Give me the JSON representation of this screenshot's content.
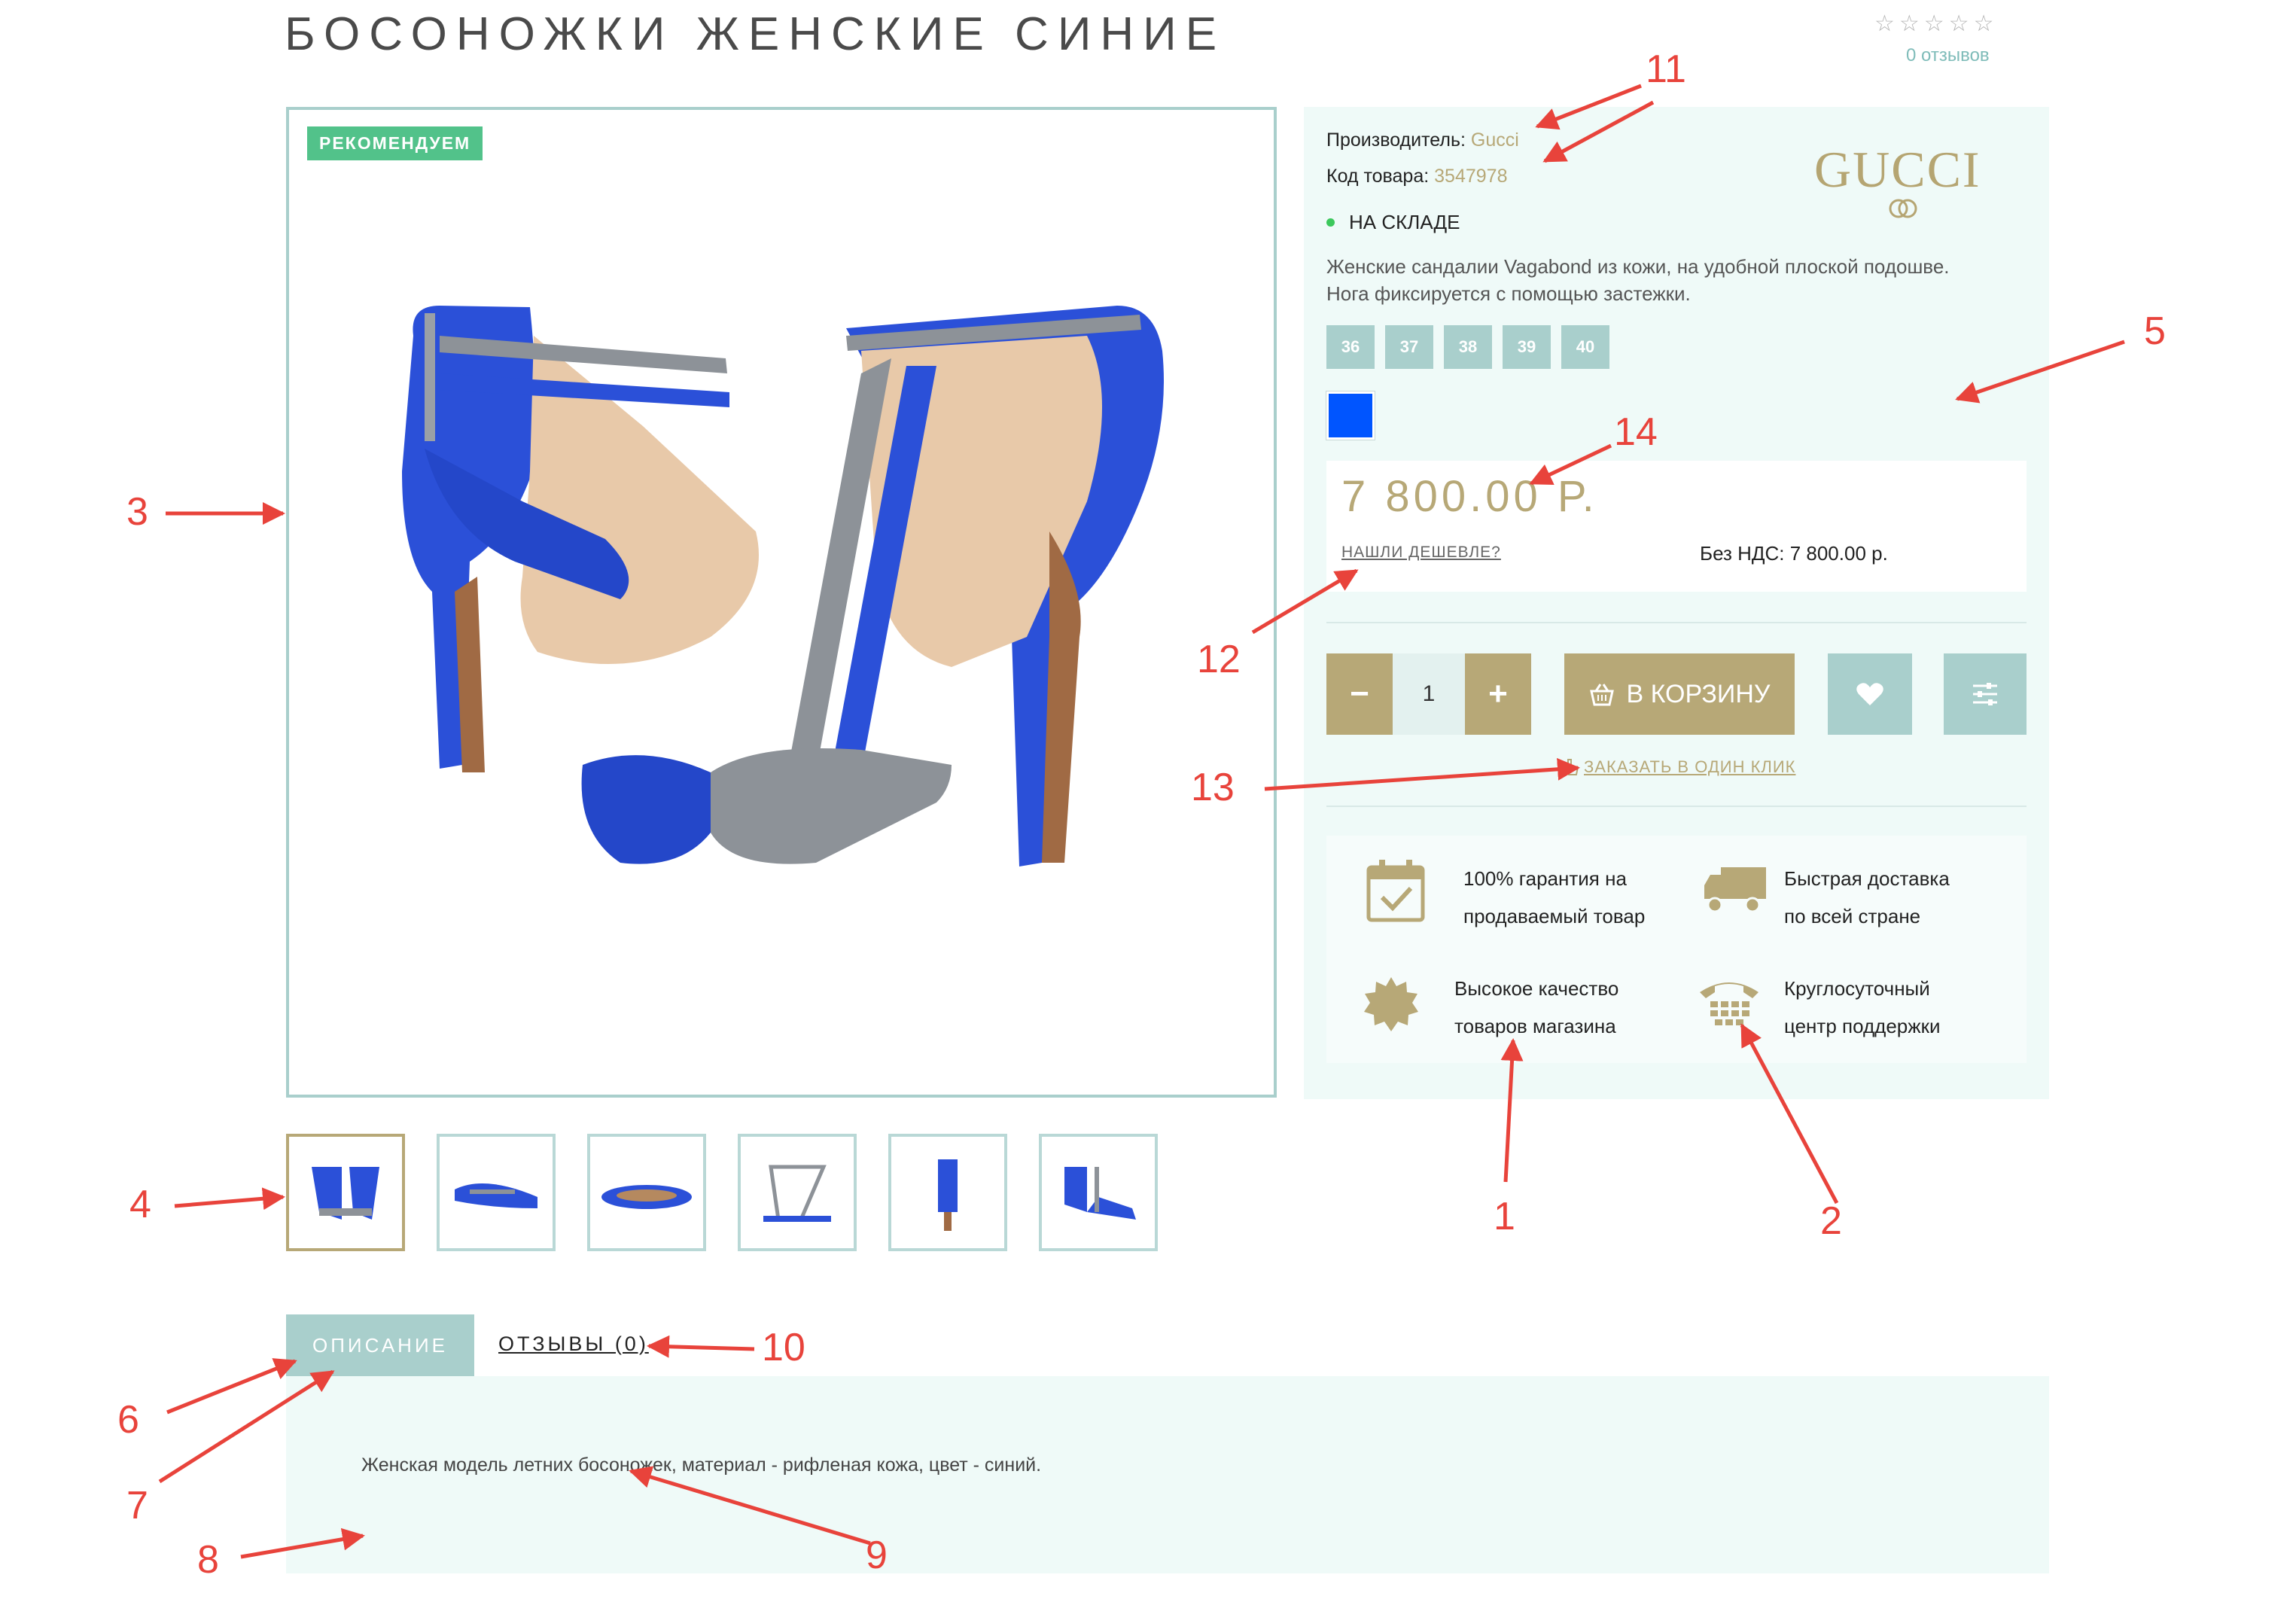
{
  "product": {
    "title": "БОСОНОЖКИ ЖЕНСКИЕ СИНИЕ",
    "stars": "☆☆☆☆☆",
    "reviews_count": "0 отзывов",
    "badge": "РЕКОМЕНДУЕМ"
  },
  "info": {
    "manufacturer_label": "Производитель:",
    "manufacturer_value": "Gucci",
    "sku_label": "Код товара:",
    "sku_value": "3547978",
    "brand_logo": "GUCCI",
    "stock": "НА СКЛАДЕ",
    "description": "Женские сандалии Vagabond из кожи, на удобной плоской подошве. Нога фиксируется с помощью застежки.",
    "sizes": [
      "36",
      "37",
      "38",
      "39",
      "40"
    ],
    "color": "#0055ff"
  },
  "price": {
    "value": "7 800.00 Р.",
    "found_cheaper": "НАШЛИ ДЕШЕВЛЕ?",
    "vat": "Без НДС: 7 800.00 р."
  },
  "buy": {
    "minus": "−",
    "quantity": "1",
    "plus": "+",
    "cart_label": "В КОРЗИНУ",
    "one_click": "ЗАКАЗАТЬ В ОДИН КЛИК"
  },
  "features": {
    "guarantee_line1": "100% гарантия на",
    "guarantee_line2": "продаваемый товар",
    "delivery_line1": "Быстрая доставка",
    "delivery_line2": "по всей стране",
    "quality_line1": "Высокое качество",
    "quality_line2": "товаров магазина",
    "support_line1": "Круглосуточный",
    "support_line2": "центр поддержки"
  },
  "tabs": {
    "description": "ОПИСАНИЕ",
    "reviews": "ОТЗЫВЫ (0)",
    "content": "Женская модель летних босоножек, материал - рифленая кожа, цвет - синий."
  },
  "annotations": {
    "n1": "1",
    "n2": "2",
    "n3": "3",
    "n4": "4",
    "n5": "5",
    "n6": "6",
    "n7": "7",
    "n8": "8",
    "n9": "9",
    "n10": "10",
    "n11": "11",
    "n12": "12",
    "n13": "13",
    "n14": "14"
  },
  "colors": {
    "accent_gold": "#b7a877",
    "accent_teal": "#a9cfcc",
    "panel_bg": "#effaf8",
    "badge_green": "#52c28a",
    "annotation_red": "#e8433b"
  }
}
